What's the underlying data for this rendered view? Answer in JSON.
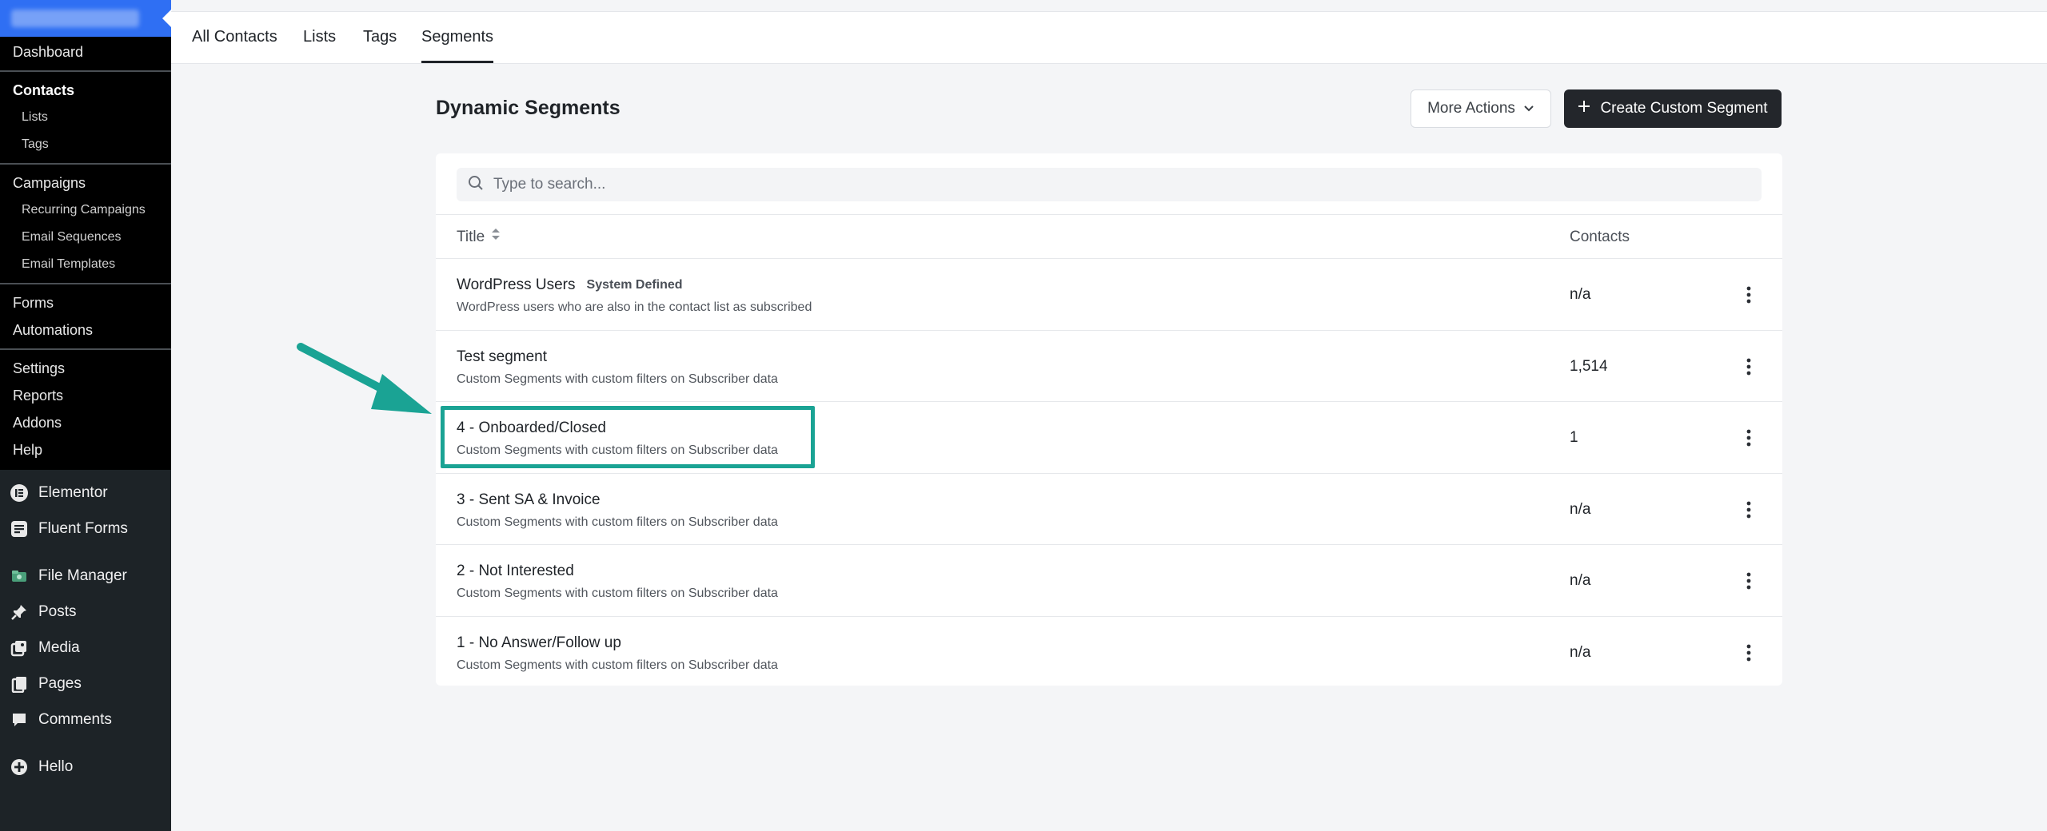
{
  "sidebar": {
    "fluentcrm_items": [
      {
        "label": "Dashboard",
        "type": "main"
      },
      {
        "label": "Contacts",
        "type": "main-active"
      },
      {
        "label": "Lists",
        "type": "sub"
      },
      {
        "label": "Tags",
        "type": "sub"
      },
      {
        "label": "Campaigns",
        "type": "main"
      },
      {
        "label": "Recurring Campaigns",
        "type": "sub"
      },
      {
        "label": "Email Sequences",
        "type": "sub"
      },
      {
        "label": "Email Templates",
        "type": "sub"
      },
      {
        "label": "Forms",
        "type": "main"
      },
      {
        "label": "Automations",
        "type": "main"
      },
      {
        "label": "Settings",
        "type": "main"
      },
      {
        "label": "Reports",
        "type": "main"
      },
      {
        "label": "Addons",
        "type": "main"
      },
      {
        "label": "Help",
        "type": "main"
      }
    ],
    "wp_items": [
      {
        "label": "Elementor",
        "icon": "elementor-icon"
      },
      {
        "label": "Fluent Forms",
        "icon": "fluent-forms-icon"
      },
      {
        "label": "File Manager",
        "icon": "file-manager-icon"
      },
      {
        "label": "Posts",
        "icon": "pin-icon"
      },
      {
        "label": "Media",
        "icon": "media-icon"
      },
      {
        "label": "Pages",
        "icon": "pages-icon"
      },
      {
        "label": "Comments",
        "icon": "comment-icon"
      },
      {
        "label": "Hello",
        "icon": "plus-circle-icon"
      }
    ]
  },
  "tabs": [
    {
      "label": "All Contacts",
      "active": false
    },
    {
      "label": "Lists",
      "active": false
    },
    {
      "label": "Tags",
      "active": false
    },
    {
      "label": "Segments",
      "active": true
    }
  ],
  "header": {
    "title": "Dynamic Segments",
    "more_actions_label": "More Actions",
    "create_label": "Create Custom Segment"
  },
  "search": {
    "placeholder": "Type to search...",
    "value": ""
  },
  "table": {
    "columns": {
      "title": "Title",
      "contacts": "Contacts"
    },
    "rows": [
      {
        "title": "WordPress Users",
        "badge": "System Defined",
        "description": "WordPress users who are also in the contact list as subscribed",
        "contacts": "n/a"
      },
      {
        "title": "Test segment",
        "badge": "",
        "description": "Custom Segments with custom filters on Subscriber data",
        "contacts": "1,514"
      },
      {
        "title": "4 - Onboarded/Closed",
        "badge": "",
        "description": "Custom Segments with custom filters on Subscriber data",
        "contacts": "1"
      },
      {
        "title": "3 - Sent SA & Invoice",
        "badge": "",
        "description": "Custom Segments with custom filters on Subscriber data",
        "contacts": "n/a"
      },
      {
        "title": "2 - Not Interested",
        "badge": "",
        "description": "Custom Segments with custom filters on Subscriber data",
        "contacts": "n/a"
      },
      {
        "title": "1 - No Answer/Follow up",
        "badge": "",
        "description": "Custom Segments with custom filters on Subscriber data",
        "contacts": "n/a"
      }
    ]
  },
  "colors": {
    "sidebar_bg": "#1d2327",
    "brand_blue": "#2f6ff3",
    "primary_button": "#23262b",
    "annotation_teal": "#1aa394"
  }
}
